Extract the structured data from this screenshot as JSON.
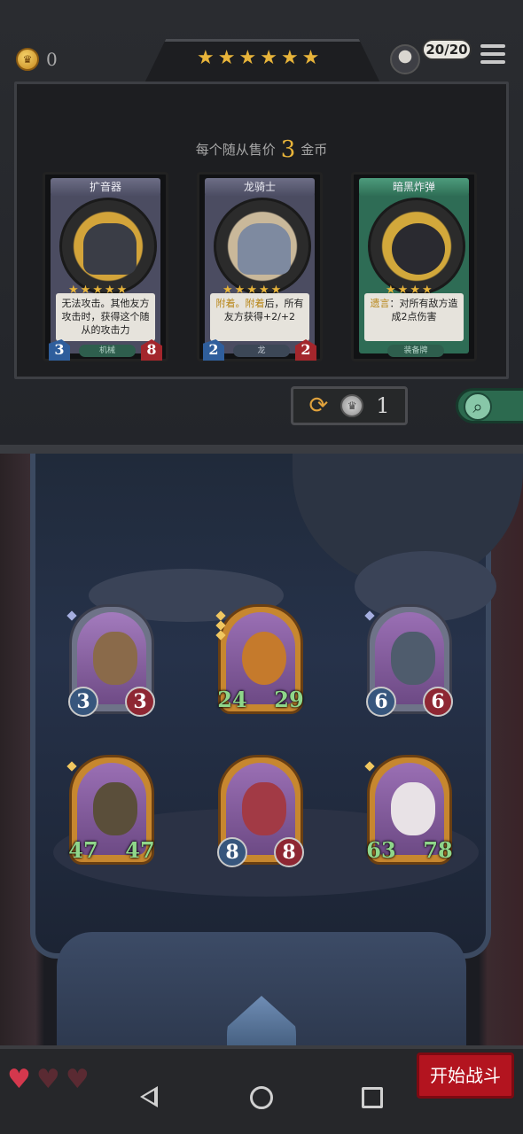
{
  "header": {
    "gold": "0",
    "star_count": 6,
    "population": "20/20",
    "sell_prefix": "每个随从售价",
    "sell_price": "3",
    "sell_suffix": "金币"
  },
  "shop_cards": [
    {
      "name": "扩音器",
      "stars": 5,
      "desc": "无法攻击。其他友方攻击时，获得这个随从的攻击力",
      "tag": "机械",
      "attack": "3",
      "health": "8",
      "frame": "purple"
    },
    {
      "name": "龙骑士",
      "stars": 5,
      "desc_kw1": "附着。",
      "desc_kw2": "附着",
      "desc_rest": "后，所有友方获得+2/+2",
      "tag": "龙",
      "attack": "2",
      "health": "2",
      "frame": "purple"
    },
    {
      "name": "暗黑炸弹",
      "stars": 4,
      "desc_kw": "遗言",
      "desc_rest": "：对所有敌方造成2点伤害",
      "tag": "装备牌",
      "attack": "",
      "health": "",
      "frame": "green"
    }
  ],
  "refresh": {
    "cost": "1"
  },
  "board_minions": [
    {
      "attack": "3",
      "health": "3",
      "style": "round"
    },
    {
      "attack": "24",
      "health": "29",
      "style": "big"
    },
    {
      "attack": "6",
      "health": "6",
      "style": "round"
    },
    {
      "attack": "47",
      "health": "47",
      "style": "big"
    },
    {
      "attack": "8",
      "health": "8",
      "style": "round"
    },
    {
      "attack": "63",
      "health": "78",
      "style": "big"
    }
  ],
  "lives": {
    "remaining": 1,
    "total": 3
  },
  "start_button": "开始战斗",
  "colors": {
    "gold": "#e8b43a",
    "start": "#b3141f",
    "attack": "#2f5e9c",
    "health": "#a3262c",
    "buff": "#8fd68a"
  },
  "icons": {
    "gold": "crown-coin-icon",
    "menu": "hamburger-icon",
    "refresh": "refresh-arrows-icon",
    "search": "magnifier-icon"
  }
}
